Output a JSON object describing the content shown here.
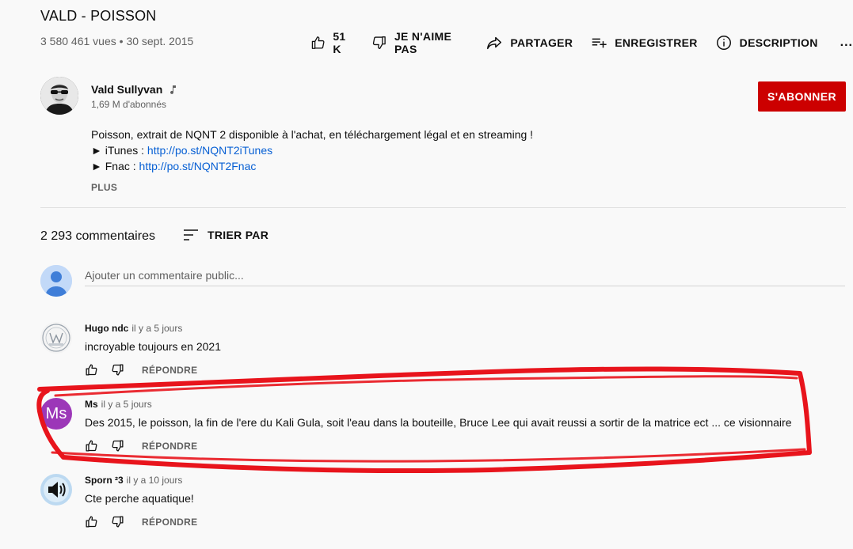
{
  "video": {
    "title": "VALD - POISSON",
    "views": "3 580 461 vues",
    "separator": "•",
    "date": "30 sept. 2015"
  },
  "actions": {
    "like_count": "51 K",
    "dislike_label": "JE N'AIME PAS",
    "share_label": "PARTAGER",
    "save_label": "ENREGISTRER",
    "description_label": "DESCRIPTION",
    "more_label": "..."
  },
  "channel": {
    "name": "Vald Sullyvan",
    "subscribers": "1,69 M d'abonnés",
    "subscribe_label": "S'ABONNER",
    "badge_icon": "music-note-icon"
  },
  "description": {
    "line1": "Poisson, extrait de NQNT 2 disponible à l'achat, en téléchargement légal et en streaming !",
    "itunes_prefix": "► iTunes : ",
    "itunes_link": "http://po.st/NQNT2iTunes",
    "fnac_prefix": "► Fnac : ",
    "fnac_link": "http://po.st/NQNT2Fnac",
    "more_label": "PLUS"
  },
  "comments_section": {
    "count": "2 293 commentaires",
    "sort_label": "TRIER PAR",
    "add_placeholder": "Ajouter un commentaire public..."
  },
  "comments": [
    {
      "author": "Hugo ndc",
      "time": "il y a 5 jours",
      "text": "incroyable toujours en 2021",
      "reply_label": "RÉPONDRE"
    },
    {
      "author": "Ms",
      "time": "il y a 5 jours",
      "avatar_initials": "Ms",
      "avatar_color": "#9c37b8",
      "text": "Des 2015, le poisson, la fin de l'ere du Kali Gula, soit l'eau dans la bouteille, Bruce Lee qui avait reussi a sortir de la matrice ect ... ce visionnaire",
      "reply_label": "RÉPONDRE"
    },
    {
      "author": "Sporn ²3",
      "time": "il y a 10 jours",
      "text": "Cte perche aquatique!",
      "reply_label": "RÉPONDRE"
    }
  ],
  "colors": {
    "subscribe_red": "#cc0000",
    "link_blue": "#065fd4",
    "annotation_red": "#e8141c"
  }
}
